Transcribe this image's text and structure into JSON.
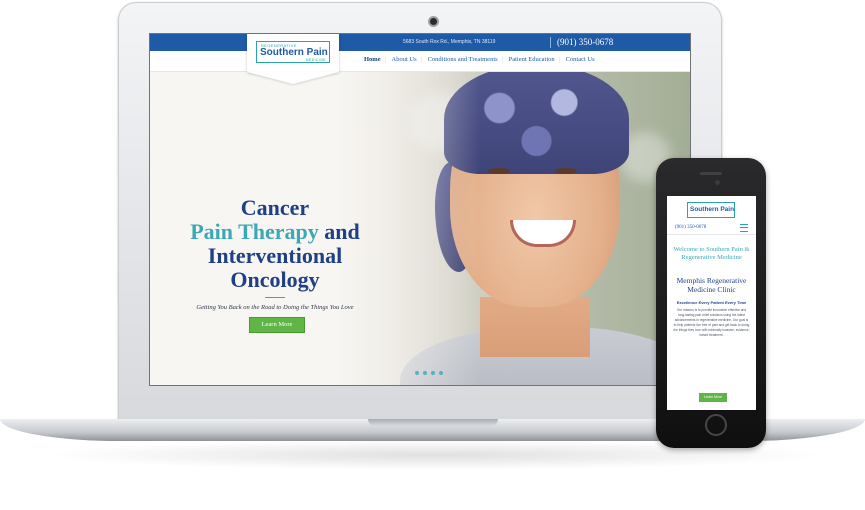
{
  "site": {
    "logo": {
      "top": "REGENERATIVE",
      "main": "Southern Pain",
      "sub": "MEDICINE"
    },
    "address": "5683 South Rox Rd., Memphis, TN 38119",
    "phone": "(901) 350-0678",
    "nav": [
      "Home",
      "About Us",
      "Conditions and Treatments",
      "Patient Education",
      "Contact Us"
    ],
    "hero": {
      "line1": "Cancer",
      "line2a": "Pain Therapy",
      "line2b": " and",
      "line3": "Interventional",
      "line4": "Oncology",
      "tagline": "Getting You Back on the Road to Doing the Things You Love",
      "button": "Learn More"
    }
  },
  "mobile": {
    "logo": "Southern Pain",
    "phone": "(901) 350-0678",
    "welcome": "Welcome to Southern Pain & Regenerative Medicine",
    "heading": "Memphis Regenerative Medicine Clinic",
    "subheading": "Excellence Every Patient Every Time",
    "body": "Our mission is to provide innovative effective and long-lasting pain relief solutions using the latest advancements in regenerative medicine. Our goal is to help patients live free of pain and get back to doing the things they love with minimally invasive, evidence-based treatment.",
    "button": "Learn More"
  },
  "colors": {
    "brand_blue": "#1f5aa6",
    "teal": "#3aa8b6",
    "navy": "#1f3f86",
    "green": "#5fb546"
  }
}
